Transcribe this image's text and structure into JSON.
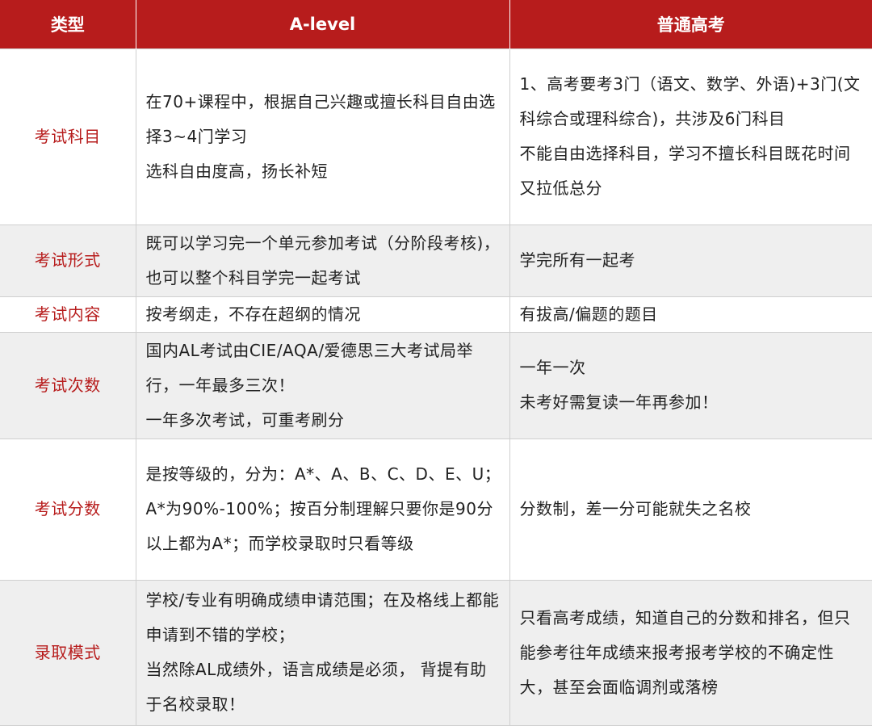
{
  "header": {
    "type": "类型",
    "alevel": "A-level",
    "gaokao": "普通高考"
  },
  "rows": [
    {
      "type": "考试科目",
      "alevel": [
        "在70+课程中，根据自己兴趣或擅长科目自由选择3~4门学习",
        "选科自由度高，扬长补短"
      ],
      "gaokao": [
        "1、高考要考3门（语文、数学、外语)+3门(文科综合或理科综合)，共涉及6门科目",
        "不能自由选择科目，学习不擅长科目既花时间又拉低总分"
      ]
    },
    {
      "type": "考试形式",
      "alevel": [
        "既可以学习完一个单元参加考试（分阶段考核)，也可以整个科目学完一起考试"
      ],
      "gaokao": [
        "学完所有一起考"
      ]
    },
    {
      "type": "考试内容",
      "alevel": [
        "按考纲走，不存在超纲的情况"
      ],
      "gaokao": [
        "有拔高/偏题的题目"
      ]
    },
    {
      "type": "考试次数",
      "alevel": [
        "国内AL考试由CIE/AQA/爱德思三大考试局举行，一年最多三次！",
        "一年多次考试，可重考刷分"
      ],
      "gaokao": [
        "一年一次",
        "未考好需复读一年再参加！"
      ]
    },
    {
      "type": "考试分数",
      "alevel": [
        "是按等级的，分为：A*、A、B、C、D、E、U；A*为90%-100%；按百分制理解只要你是90分以上都为A*；而学校录取时只看等级"
      ],
      "gaokao": [
        "分数制，差一分可能就失之名校"
      ]
    },
    {
      "type": "录取模式",
      "alevel": [
        "学校/专业有明确成绩申请范围；在及格线上都能申请到不错的学校；",
        "当然除AL成绩外，语言成绩是必须，  背提有助于名校录取！"
      ],
      "gaokao": [
        "只看高考成绩，知道自己的分数和排名，但只能参考往年成绩来报考报考学校的不确定性大，甚至会面临调剂或落榜"
      ]
    }
  ]
}
